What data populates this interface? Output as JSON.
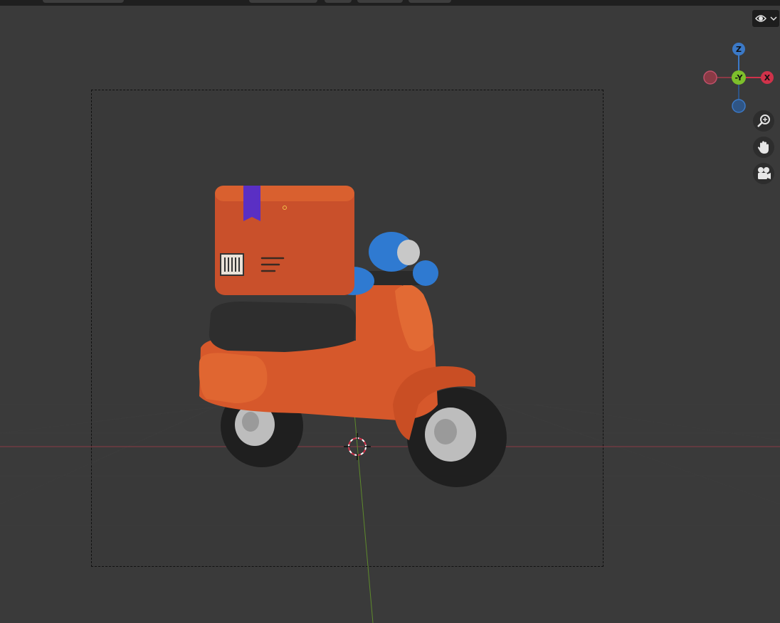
{
  "viewport": {
    "gizmo": {
      "z_label": "Z",
      "y_label": "-Y",
      "x_label": "X",
      "colors": {
        "x": "#d0324a",
        "y": "#7dbf2b",
        "z": "#3b79c7",
        "neg_x": "#8a3a45",
        "neg_z": "#2f5585"
      }
    },
    "overlay_icons": [
      "visibility-eye-icon",
      "zoom-icon",
      "pan-hand-icon",
      "camera-icon"
    ],
    "object_colors": {
      "body": "#d6582b",
      "seat": "#2e2e2e",
      "box": "#c9502b",
      "ribbon": "#5a2fc4",
      "mirrors": "#2f7ad1",
      "tire": "#1e1e1e",
      "rim": "#bcbcbc"
    }
  }
}
